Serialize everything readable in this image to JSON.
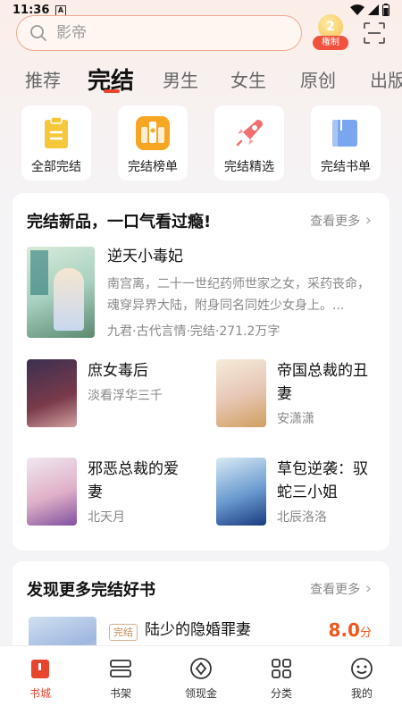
{
  "status": {
    "time": "11:36",
    "notif": "A"
  },
  "search": {
    "placeholder": "影帝",
    "vip_label": "権制"
  },
  "tabs": [
    {
      "label": "推荐"
    },
    {
      "label": "完结"
    },
    {
      "label": "男生"
    },
    {
      "label": "女生"
    },
    {
      "label": "原创"
    },
    {
      "label": "出版"
    }
  ],
  "shortcuts": [
    {
      "label": "全部完结",
      "icon": "document-icon"
    },
    {
      "label": "完结榜单",
      "icon": "ranking-icon"
    },
    {
      "label": "完结精选",
      "icon": "rocket-icon"
    },
    {
      "label": "完结书单",
      "icon": "book-icon"
    }
  ],
  "section1": {
    "title": "完结新品，一口气看过瘾!",
    "more": "查看更多",
    "featured": {
      "title": "逆天小毒妃",
      "desc": "南宫离，二十一世纪药师世家之女，采药丧命，魂穿异界大陆，附身同名同姓少女身上。...",
      "meta": "九君·古代言情·完结·271.2万字"
    },
    "books": [
      {
        "title": "庶女毒后",
        "author": "淡看浮华三千"
      },
      {
        "title": "帝国总裁的丑妻",
        "author": "安潇潇"
      },
      {
        "title": "邪恶总裁的爱妻",
        "author": "北天月"
      },
      {
        "title": "草包逆袭：驭蛇三小姐",
        "author": "北辰洛洛"
      }
    ]
  },
  "section2": {
    "title": "发现更多完结好书",
    "more": "查看更多",
    "book": {
      "tag": "完结",
      "title": "陆少的隐婚罪妻",
      "score": "8.0",
      "score_unit": "分"
    }
  },
  "bottom_nav": [
    {
      "label": "书城"
    },
    {
      "label": "书架"
    },
    {
      "label": "领现金"
    },
    {
      "label": "分类"
    },
    {
      "label": "我的"
    }
  ],
  "colors": {
    "accent": "#e8452f",
    "score": "#f0561f"
  }
}
